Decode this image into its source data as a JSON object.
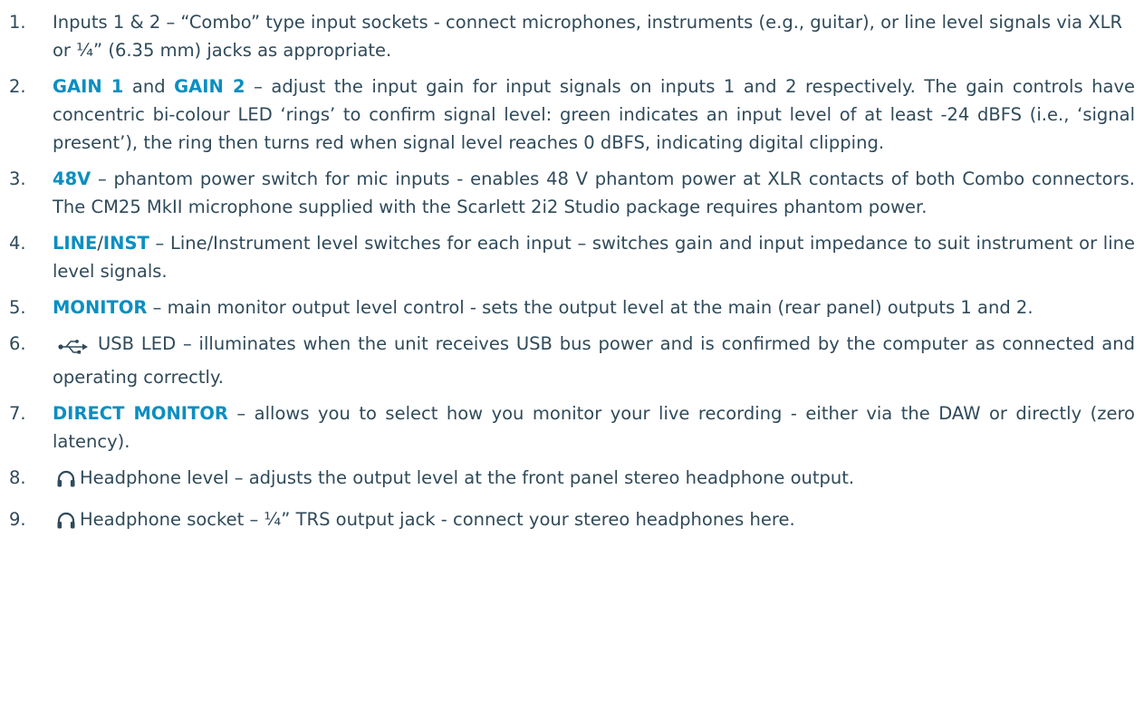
{
  "items": [
    {
      "num": "1.",
      "text": "Inputs 1 & 2 – “Combo” type input sockets - connect microphones, instruments (e.g., guitar), or line level signals via XLR or ¼” (6.35 mm) jacks as appropriate."
    },
    {
      "num": "2.",
      "term1": "GAIN 1",
      "and": " and ",
      "term2": "GAIN 2",
      "text": " – adjust the input gain for input signals on inputs 1 and 2 respectively. The gain controls have concentric bi-colour LED ‘rings’ to confirm signal level: green indicates an input level of at least -24 dBFS (i.e., ‘signal present’), the ring then turns red when signal level reaches 0 dBFS, indicating digital clipping."
    },
    {
      "num": "3.",
      "term": "48V",
      "text": " – phantom power switch for mic inputs - enables 48 V phantom power at XLR contacts of both Combo connectors. The CM25 MkII microphone supplied with the Scarlett 2i2 Studio package requires phantom power."
    },
    {
      "num": "4.",
      "term": "LINE",
      "sep": "/",
      "term2": "INST",
      "text": " – Line/Instrument level switches for each input – switches gain and input impedance to suit instrument or line level signals."
    },
    {
      "num": "5.",
      "term": "MONITOR",
      "text": " – main monitor output level control - sets the output level at the main (rear panel) outputs 1 and 2."
    },
    {
      "num": "6.",
      "icon": "usb-icon",
      "text": "USB LED – illuminates when the unit receives USB bus power and is confirmed by the computer as connected and operating correctly."
    },
    {
      "num": "7.",
      "term": "DIRECT MONITOR",
      "text": " – allows you to select how you monitor your live recording - either via the DAW or directly (zero latency)."
    },
    {
      "num": "8.",
      "icon": "headphone-icon",
      "text": "Headphone level – adjusts the output level at the front panel stereo headphone output."
    },
    {
      "num": "9.",
      "icon": "headphone-icon",
      "text": "Headphone socket – ¼” TRS output jack - connect your stereo headphones here."
    }
  ],
  "colors": {
    "body_text": "#2f4a5a",
    "term": "#0b8ec1"
  }
}
